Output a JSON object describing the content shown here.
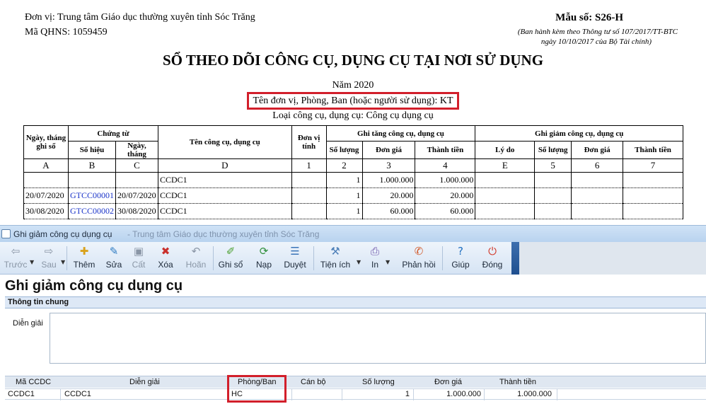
{
  "report": {
    "unit": "Đơn vị: Trung tâm Giáo dục thường xuyên tỉnh Sóc Trăng",
    "qhns": "Mã QHNS: 1059459",
    "form_no": "Mẫu số: S26-H",
    "note_line1": "(Ban hành kèm theo Thông tư số 107/2017/TT-BTC",
    "note_line2": "ngày 10/10/2017 của Bộ Tài chính)",
    "title": "SỔ THEO DÕI CÔNG CỤ, DỤNG CỤ TẠI NƠI SỬ DỤNG",
    "year": "Năm 2020",
    "department": "Tên đơn vị, Phòng, Ban (hoặc người sử dụng): KT",
    "tool_type": "Loại công cụ, dụng cụ: Công cụ dụng cụ",
    "headers": {
      "date": "Ngày, tháng ghi sổ",
      "voucher": "Chứng từ",
      "voucher_no": "Số hiệu",
      "voucher_date": "Ngày, tháng",
      "name": "Tên công cụ, dụng cụ",
      "unit": "Đơn vị tính",
      "increase": "Ghi tăng công cụ, dụng cụ",
      "qty": "Số lượng",
      "price": "Đơn giá",
      "amount": "Thành tiền",
      "decrease": "Ghi giảm công cụ, dụng cụ",
      "reason": "Lý do",
      "qty2": "Số lượng",
      "price2": "Đơn giá",
      "amount2": "Thành tiền"
    },
    "index_row": [
      "A",
      "B",
      "C",
      "D",
      "1",
      "2",
      "3",
      "4",
      "E",
      "5",
      "6",
      "7"
    ],
    "rows": [
      {
        "date": "",
        "voucher_no": "",
        "voucher_date": "",
        "name": "CCDC1",
        "qty": "1",
        "price": "1.000.000",
        "amount": "1.000.000"
      },
      {
        "date": "20/07/2020",
        "voucher_no": "GTCC00001",
        "voucher_date": "20/07/2020",
        "name": "CCDC1",
        "qty": "1",
        "price": "20.000",
        "amount": "20.000"
      },
      {
        "date": "30/08/2020",
        "voucher_no": "GTCC00002",
        "voucher_date": "30/08/2020",
        "name": "CCDC1",
        "qty": "1",
        "price": "60.000",
        "amount": "60.000"
      }
    ]
  },
  "app": {
    "window_title": "Ghi giảm công cụ dụng cụ",
    "window_title_ghost": "- Trung tâm Giáo dục thường xuyên tỉnh Sóc Trăng",
    "toolbar": [
      {
        "label": "Trước",
        "icon": "arrow-left-icon",
        "glyph": "⇦",
        "color": "#8a96a6",
        "enabled": false
      },
      {
        "label": "Sau",
        "icon": "arrow-right-icon",
        "glyph": "⇨",
        "color": "#8a96a6",
        "enabled": false
      },
      {
        "label": "Thêm",
        "icon": "add-doc-icon",
        "glyph": "✚",
        "color": "#d9a21b",
        "enabled": true
      },
      {
        "label": "Sửa",
        "icon": "edit-icon",
        "glyph": "✎",
        "color": "#2e7bc2",
        "enabled": true
      },
      {
        "label": "Cất",
        "icon": "save-icon",
        "glyph": "▣",
        "color": "#8a96a6",
        "enabled": false
      },
      {
        "label": "Xóa",
        "icon": "delete-icon",
        "glyph": "✖",
        "color": "#c9302c",
        "enabled": true
      },
      {
        "label": "Hoãn",
        "icon": "undo-icon",
        "glyph": "↶",
        "color": "#8a96a6",
        "enabled": false
      },
      {
        "label": "Ghi sổ",
        "icon": "post-icon",
        "glyph": "✐",
        "color": "#4a9f2f",
        "enabled": true
      },
      {
        "label": "Nạp",
        "icon": "reload-icon",
        "glyph": "⟳",
        "color": "#2f8f3a",
        "enabled": true
      },
      {
        "label": "Duyệt",
        "icon": "review-icon",
        "glyph": "☰",
        "color": "#3a74b8",
        "enabled": true
      },
      {
        "label": "Tiện ích",
        "icon": "utilities-icon",
        "glyph": "⚒",
        "color": "#4d7fb8",
        "enabled": true
      },
      {
        "label": "In",
        "icon": "print-icon",
        "glyph": "⎙",
        "color": "#6a4fa8",
        "enabled": true
      },
      {
        "label": "Phản hồi",
        "icon": "feedback-icon",
        "glyph": "✆",
        "color": "#d25a2a",
        "enabled": true
      },
      {
        "label": "Giúp",
        "icon": "help-icon",
        "glyph": "?",
        "color": "#1f6fc0",
        "enabled": true
      },
      {
        "label": "Đóng",
        "icon": "close-icon",
        "glyph": "⏻",
        "color": "#d23a2a",
        "enabled": true
      }
    ],
    "form_title": "Ghi giảm công cụ dụng cụ",
    "section_general": "Thông tin chung",
    "description_label": "Diễn giải",
    "description_value": "",
    "grid_headers": [
      "Mã CCDC",
      "Diễn giải",
      "Phòng/Ban",
      "Cán bộ",
      "Số lượng",
      "Đơn giá",
      "Thành tiền"
    ],
    "grid_rows": [
      {
        "code": "CCDC1",
        "desc": "CCDC1",
        "dept": "HC",
        "staff": "",
        "qty": "1",
        "price": "1.000.000",
        "amount": "1.000.000"
      }
    ]
  }
}
